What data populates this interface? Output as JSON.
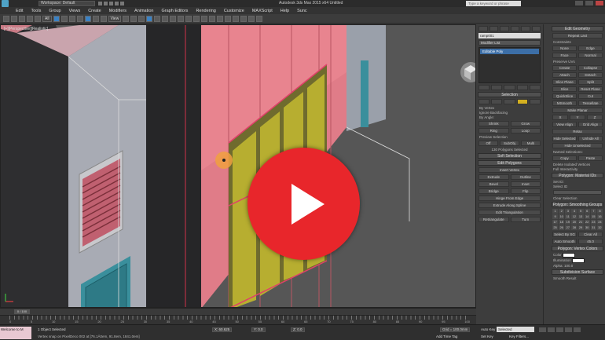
{
  "titlebar": {
    "workspace": "Workspace: Default",
    "title": "Autodesk 3ds Max 2015 x64    Untitled",
    "search_placeholder": "Type a keyword or phrase"
  },
  "menu": [
    "Edit",
    "Tools",
    "Group",
    "Views",
    "Create",
    "Modifiers",
    "Animation",
    "Graph Editors",
    "Rendering",
    "Customize",
    "MAXScript",
    "Help",
    "Sunc"
  ],
  "toolbar": {
    "filter": "All",
    "view": "View"
  },
  "viewport": {
    "label": "[+][Perspective][Realistic]"
  },
  "command_panel": {
    "object_name": "ramp001",
    "modifier_list": "Modifier List",
    "stack_item": "Editable Poly",
    "selection": {
      "title": "Selection",
      "by_vertex": "By Vertex",
      "ignore_backfacing": "Ignore Backfacing",
      "by_angle": "By Angle:",
      "shrink": "Shrink",
      "grow": "Grow",
      "ring": "Ring",
      "loop": "Loop",
      "preview": "Preview Selection",
      "off": "Off",
      "subobj": "SubObj",
      "multi": "Multi",
      "count": "130 Polygons Selected"
    },
    "soft_selection": "Soft Selection",
    "edit_polygons": {
      "title": "Edit Polygons",
      "insert_vertex": "Insert Vertex",
      "extrude": "Extrude",
      "outline": "Outline",
      "bevel": "Bevel",
      "inset": "Inset",
      "bridge": "Bridge",
      "flip": "Flip",
      "hinge": "Hinge From Edge",
      "extrude_spline": "Extrude Along Spline",
      "edit_tri": "Edit Triangulation",
      "retriangulate": "Retriangulate",
      "turn": "Turn"
    },
    "edit_geometry": {
      "title": "Edit Geometry",
      "repeat_last": "Repeat Last",
      "constraints": "Constraints",
      "none": "None",
      "edge": "Edge",
      "face": "Face",
      "normal": "Normal",
      "preserve_uvs": "Preserve UVs",
      "create": "Create",
      "collapse": "Collapse",
      "attach": "Attach",
      "detach": "Detach",
      "slice_plane": "Slice Plane",
      "split": "Split",
      "slice": "Slice",
      "reset_plane": "Reset Plane",
      "quickslice": "QuickSlice",
      "cut": "Cut",
      "msmooth": "MSmooth",
      "tessellate": "Tessellate",
      "make_planar": "Make Planar",
      "x": "X",
      "y": "Y",
      "z": "Z",
      "view_align": "View Align",
      "grid_align": "Grid Align",
      "relax": "Relax",
      "hide_selected": "Hide Selected",
      "unhide_all": "Unhide All",
      "hide_unselected": "Hide Unselected",
      "named_selections": "Named Selections:",
      "copy": "Copy",
      "paste": "Paste",
      "delete_isolated": "Delete Isolated Vertices",
      "full_interactivity": "Full Interactivity"
    },
    "material_ids": {
      "title": "Polygon: Material IDs",
      "set_id": "Set ID:",
      "select_id": "Select ID",
      "clear_selection": "Clear Selection"
    },
    "smoothing_groups": {
      "title": "Polygon: Smoothing Groups",
      "numbers": [
        "1",
        "2",
        "3",
        "4",
        "5",
        "6",
        "7",
        "8",
        "9",
        "10",
        "11",
        "12",
        "13",
        "14",
        "15",
        "16",
        "17",
        "18",
        "19",
        "20",
        "21",
        "22",
        "23",
        "24",
        "25",
        "26",
        "27",
        "28",
        "29",
        "30",
        "31",
        "32"
      ],
      "select_by_sg": "Select By SG",
      "clear_all": "Clear All",
      "auto_smooth": "Auto Smooth",
      "auto_value": "45.0"
    },
    "vertex_colors": {
      "title": "Polygon: Vertex Colors",
      "color": "Color",
      "illumination": "Illumination",
      "alpha": "Alpha:",
      "alpha_value": "100.0"
    },
    "subdivision": {
      "title": "Subdivision Surface",
      "smooth_result": "Smooth Result"
    }
  },
  "timeline": {
    "frame": "0 / 100",
    "ticks": [
      "0",
      "5",
      "10",
      "15",
      "20",
      "25",
      "30",
      "35",
      "40",
      "45",
      "50",
      "55",
      "60",
      "65",
      "70",
      "75",
      "80",
      "85",
      "90",
      "95",
      "100"
    ]
  },
  "status": {
    "listener": "Welcome to M",
    "line1": "1 Object Selected",
    "line2": "Vertex snap on PixelDeco 002 at [76.1Ã0em, 91.8em, 1841.0em]",
    "x": "X: 60.625",
    "y": "Y: 0.0",
    "z": "Z: 0.0",
    "grid": "Grid = 100.0mm",
    "add_time_tag": "Add Time Tag",
    "auto_key": "Auto Key",
    "selected": "Selected",
    "set_key": "Set Key",
    "key_filters": "Key Filters..."
  }
}
